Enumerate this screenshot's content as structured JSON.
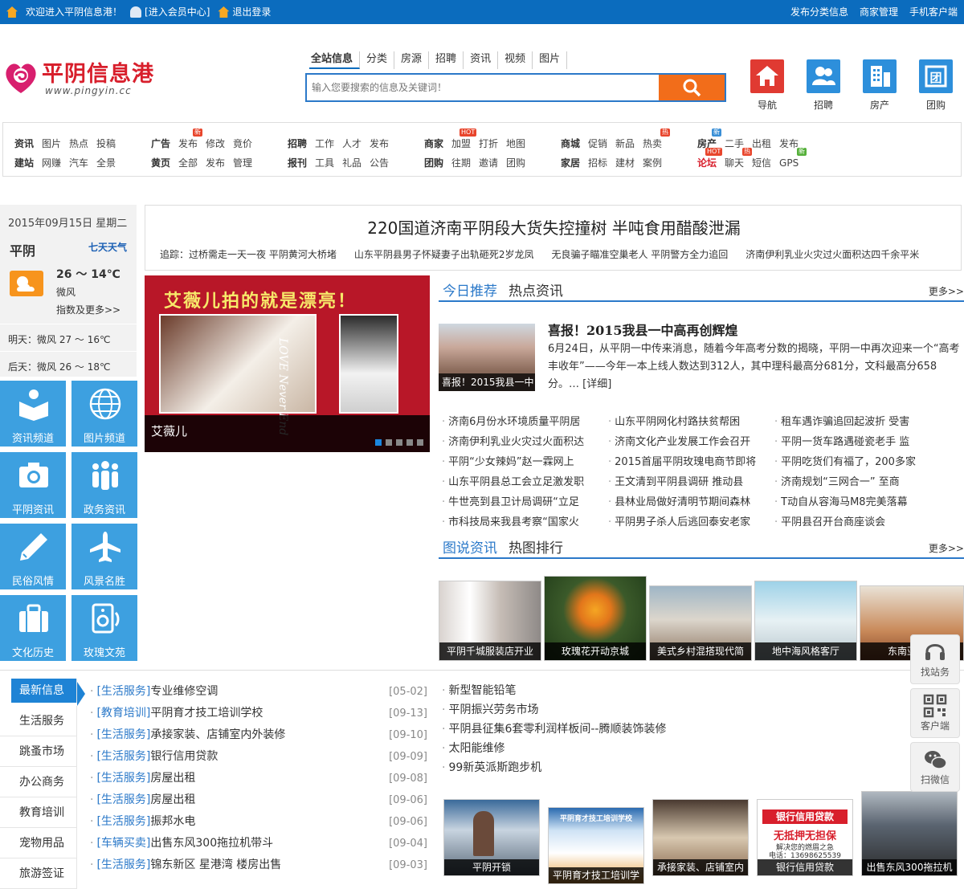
{
  "topbar": {
    "welcome": "欢迎进入平阴信息港！",
    "member": "[进入会员中心]",
    "logout": "退出登录",
    "links": [
      "发布分类信息",
      "商家管理",
      "手机客户端"
    ]
  },
  "logo": {
    "title": "平阴信息港",
    "url": "www.pingyin.cc"
  },
  "search": {
    "tabs": [
      "全站信息",
      "分类",
      "房源",
      "招聘",
      "资讯",
      "视频",
      "图片"
    ],
    "placeholder": "输入您要搜索的信息及关键词！"
  },
  "quick_tiles": [
    {
      "label": "导航",
      "color": "#e03a32",
      "icon": "home-icon"
    },
    {
      "label": "招聘",
      "color": "#2d8fdb",
      "icon": "people-icon"
    },
    {
      "label": "房产",
      "color": "#2d8fdb",
      "icon": "building-icon"
    },
    {
      "label": "团购",
      "color": "#2d8fdb",
      "icon": "group-icon"
    }
  ],
  "nav": {
    "groups": [
      {
        "r1": [
          "资讯",
          "图片",
          "热点",
          "投稿"
        ],
        "r2": [
          "建站",
          "网赚",
          "汽车",
          "全景"
        ]
      },
      {
        "r1": [
          "广告",
          "发布",
          "修改",
          "竟价"
        ],
        "r2": [
          "黄页",
          "全部",
          "发布",
          "管理"
        ]
      },
      {
        "r1": [
          "招聘",
          "工作",
          "人才",
          "发布"
        ],
        "r2": [
          "报刊",
          "工具",
          "礼品",
          "公告"
        ]
      },
      {
        "r1": [
          "商家",
          "加盟",
          "打折",
          "地图"
        ],
        "r2": [
          "团购",
          "往期",
          "邀请",
          "团购"
        ]
      },
      {
        "r1": [
          "商城",
          "促销",
          "新品",
          "热卖"
        ],
        "r2": [
          "家居",
          "招标",
          "建材",
          "案例"
        ]
      },
      {
        "r1": [
          "房产",
          "二手",
          "出租",
          "发布"
        ],
        "r2": [
          "论坛",
          "聊天",
          "短信",
          "GPS"
        ]
      }
    ],
    "tags": {
      "new": "新",
      "hot": "HOT",
      "re": "热"
    }
  },
  "weather": {
    "date": "2015年09月15日  星期二",
    "city": "平阴",
    "link": "七天天气",
    "temp": "26 ～ 14℃",
    "wind": "微风",
    "more": "指数及更多>>",
    "tomorrow": "明天：微风  27 ～ 16℃",
    "after": "后天：微风  26 ～ 18℃"
  },
  "channels": [
    {
      "label": "资讯频道",
      "icon": "book-reader-icon"
    },
    {
      "label": "图片频道",
      "icon": "globe-icon"
    },
    {
      "label": "平阴资讯",
      "icon": "camera-icon"
    },
    {
      "label": "政务资讯",
      "icon": "group-people-icon"
    },
    {
      "label": "民俗风情",
      "icon": "pencil-icon"
    },
    {
      "label": "风景名胜",
      "icon": "airplane-icon"
    },
    {
      "label": "文化历史",
      "icon": "suitcase-icon"
    },
    {
      "label": "玫瑰文苑",
      "icon": "speaker-icon"
    }
  ],
  "headline": {
    "title": "220国道济南平阴段大货失控撞树 半吨食用醋酸泄漏",
    "subs": [
      "追踪：过桥需走一天一夜 平阴黄河大桥堵",
      "山东平阴县男子怀疑妻子出轨砸死2岁龙凤",
      "无良骗子瞄准空巢老人 平阴警方全力追回",
      "济南伊利乳业火灾过火面积达四千余平米"
    ]
  },
  "slide": {
    "banner": "艾薇儿拍的就是漂亮！",
    "caption": "艾薇儿",
    "brand": "LOVE Never End"
  },
  "rec": {
    "tab_active": "今日推荐",
    "tab_other": "热点资讯",
    "more": "更多>>",
    "feature": {
      "img_caption": "喜报！2015我县一中",
      "title": "喜报！2015我县一中高再创辉煌",
      "text": "6月24日，从平阴一中传来消息，随着今年高考分数的揭晓，平阴一中再次迎来一个“高考丰收年”——今年一本上线人数达到312人，其中理科最高分681分，文科最高分658分。… [详细]"
    },
    "col1": [
      "济南6月份水环境质量平阴居",
      "济南伊利乳业火灾过火面积达",
      "平阴“少女辣妈”赵一霖网上",
      "山东平阴县总工会立足激发职",
      "牛世亮到县卫计局调研“立足",
      "市科技局来我县考察“国家火"
    ],
    "col2": [
      "山东平阴网化村路扶贫帮困",
      "济南文化产业发展工作会召开",
      "2015首届平阴玫瑰电商节即将",
      "王文清到平阴县调研 推动县",
      "县林业局做好清明节期间森林",
      "平阴男子杀人后逃回泰安老家"
    ],
    "col3": [
      "租车遇诈骗追回起波折 受害",
      "平阴一货车路遇碰瓷老手 监",
      "平阴吃货们有福了，200多家",
      "济南规划“三网合一” 至商",
      "T动自从容海马M8完美落幕",
      "平阴县召开台商座谈会"
    ]
  },
  "photos": {
    "tab_active": "图说资讯",
    "tab_other": "热图排行",
    "more": "更多>>",
    "items": [
      "平阴千城服装店开业",
      "玫瑰花开动京城",
      "美式乡村混搭现代简",
      "地中海风格客厅",
      "东南亚风格"
    ]
  },
  "categories": [
    "最新信息",
    "生活服务",
    "跳蚤市场",
    "办公商务",
    "教育培训",
    "宠物用品",
    "旅游签证"
  ],
  "latest": [
    {
      "cat": "[生活服务]",
      "title": "专业维修空调",
      "date": "[05-02]"
    },
    {
      "cat": "[教育培训]",
      "title": "平阴育才技工培训学校",
      "date": "[09-13]"
    },
    {
      "cat": "[生活服务]",
      "title": "承接家装、店铺室内外装修",
      "date": "[09-10]"
    },
    {
      "cat": "[生活服务]",
      "title": "银行信用贷款",
      "date": "[09-09]"
    },
    {
      "cat": "[生活服务]",
      "title": "房屋出租",
      "date": "[09-08]"
    },
    {
      "cat": "[生活服务]",
      "title": "房屋出租",
      "date": "[09-06]"
    },
    {
      "cat": "[生活服务]",
      "title": "振邦水电",
      "date": "[09-06]"
    },
    {
      "cat": "[车辆买卖]",
      "title": "出售东风300拖拉机带斗",
      "date": "[09-04]"
    },
    {
      "cat": "[生活服务]",
      "title": "锦东新区 星港湾 楼房出售",
      "date": "[09-03]"
    }
  ],
  "right_list": [
    "新型智能铅笔",
    "平阴振兴劳务市场",
    "平阴县征集6套零利润样板间--腾顺装饰装修",
    "太阳能维修",
    "99新英派斯跑步机"
  ],
  "bottom_pics": [
    "平阴开锁",
    "平阴育才技工培训学",
    "承接家装、店铺室内",
    "银行信用贷款",
    "出售东风300拖拉机"
  ],
  "bottom_pic_texts": {
    "school": "平阴育才技工培训学校",
    "bank_title": "银行信用贷款",
    "bank_sub": "无抵押无担保",
    "bank_line": "解决您的燃眉之急",
    "bank_phone": "电话：13698625539"
  },
  "floating": [
    "找站务",
    "客户端",
    "扫微信"
  ],
  "colors": {
    "blue": "#0b6cbe",
    "accent": "#2b79c9",
    "red": "#d81f2c",
    "orange": "#f26d1a",
    "tile": "#3da0e0"
  }
}
